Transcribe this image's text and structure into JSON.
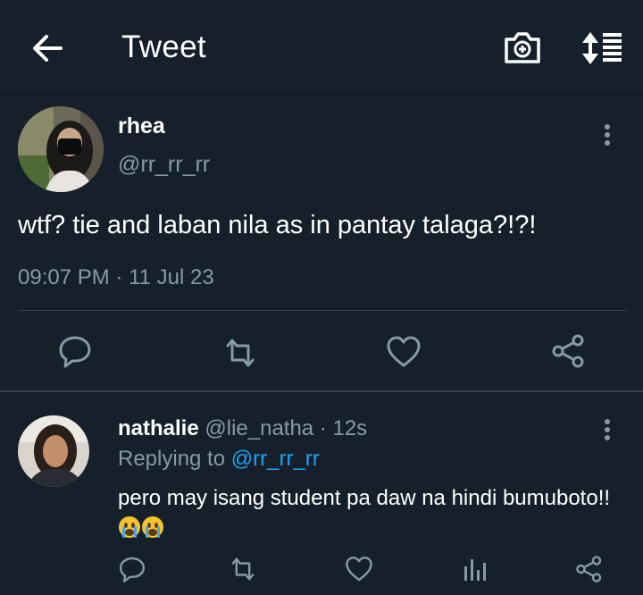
{
  "header": {
    "title": "Tweet"
  },
  "tweet": {
    "display_name": "rhea",
    "handle": "@rr_rr_rr",
    "text": "wtf? tie and laban nila as in pantay talaga?!?!",
    "time": "09:07 PM",
    "sep": " · ",
    "date": "11 Jul 23"
  },
  "reply": {
    "display_name": "nathalie",
    "handle": "@lie_natha",
    "time_ago": "· 12s",
    "replying_prefix": "Replying to ",
    "replying_to": "@rr_rr_rr",
    "text": "pero may isang student pa daw na hindi bumuboto!!"
  },
  "icons": [
    "back-arrow-icon",
    "camera-icon",
    "sort-icon",
    "more-icon",
    "reply-icon",
    "retweet-icon",
    "like-icon",
    "share-icon",
    "analytics-icon",
    "crying-emoji-icon"
  ],
  "colors": {
    "background": "#15202b",
    "secondary_text": "#8899a6",
    "accent": "#1da1f2",
    "divider": "#38444d"
  }
}
